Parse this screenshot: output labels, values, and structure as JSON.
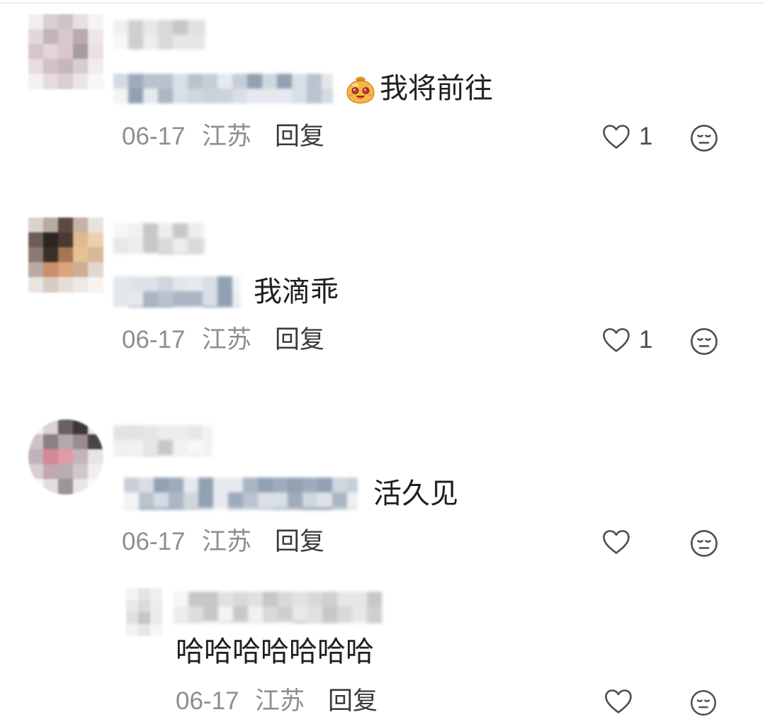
{
  "comments": [
    {
      "emoji": "money-bag-face-emoji",
      "text": "我将前往",
      "date": "06-17",
      "location": "江苏",
      "reply_label": "回复",
      "like_count": "1"
    },
    {
      "text": "我滴乖",
      "date": "06-17",
      "location": "江苏",
      "reply_label": "回复",
      "like_count": "1"
    },
    {
      "text": "活久见",
      "date": "06-17",
      "location": "江苏",
      "reply_label": "回复",
      "replies": [
        {
          "text": "哈哈哈哈哈哈哈",
          "date": "06-17",
          "location": "江苏",
          "reply_label": "回复"
        }
      ]
    }
  ],
  "icons": {
    "like": "heart-outline-icon",
    "dislike": "meh-face-icon"
  },
  "colors": {
    "background": "#ffffff",
    "text": "#1f1f1f",
    "meta": "#8e8e8e",
    "reply_label": "#3a3a3a",
    "icon": "#4d4d4d"
  }
}
